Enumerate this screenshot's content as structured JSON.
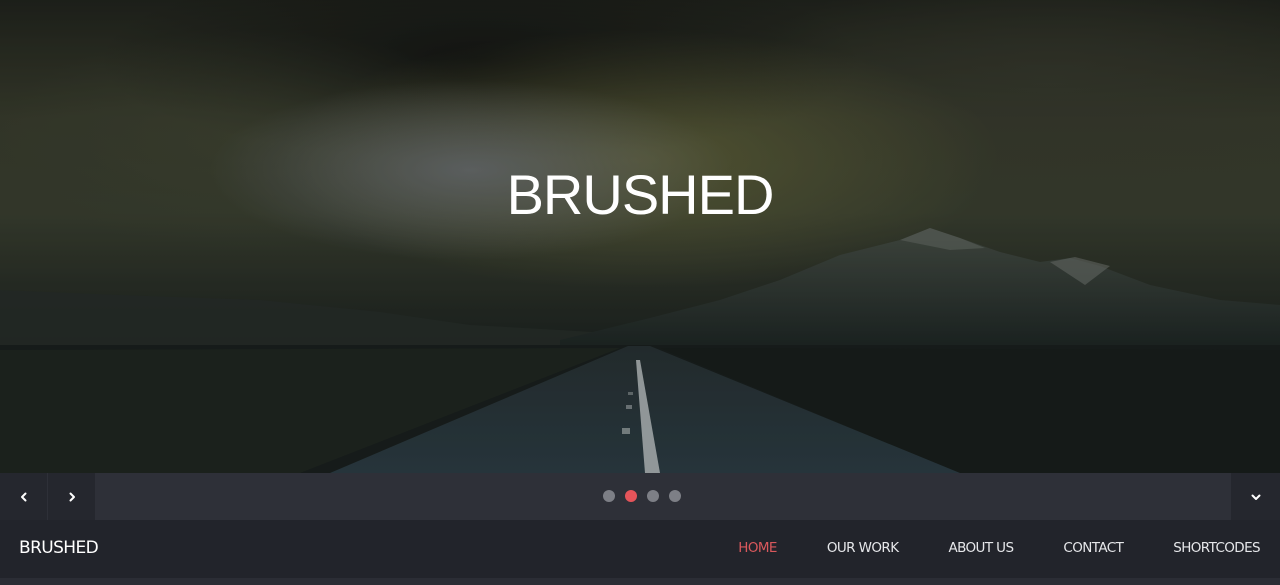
{
  "hero": {
    "title": "BRUSHED",
    "background_description": "dark stormy sky over mountains with a road leading to the horizon"
  },
  "slider": {
    "prev_icon": "chevron-left-icon",
    "next_icon": "chevron-right-icon",
    "scroll_down_icon": "chevron-down-icon",
    "slide_count": 4,
    "active_slide": 2,
    "dot_color": "#7d7f86",
    "active_dot_color": "#e5545a"
  },
  "navbar": {
    "logo": "BRUSHED",
    "items": [
      {
        "label": "HOME",
        "active": true
      },
      {
        "label": "OUR WORK",
        "active": false
      },
      {
        "label": "ABOUT US",
        "active": false
      },
      {
        "label": "CONTACT",
        "active": false
      },
      {
        "label": "SHORTCODES",
        "active": false
      }
    ],
    "active_color": "#d9585c"
  }
}
